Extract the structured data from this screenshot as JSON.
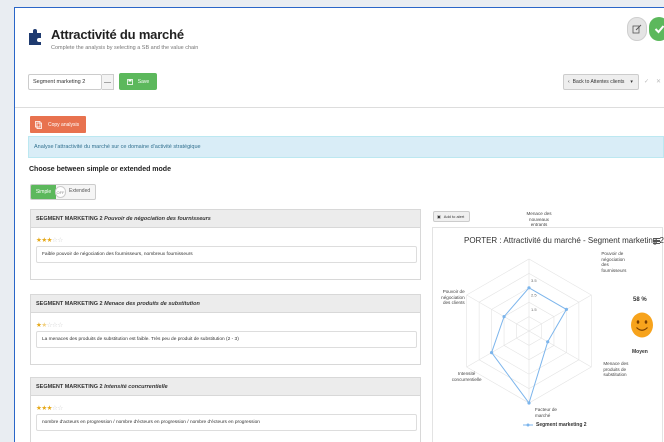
{
  "header": {
    "title": "Attractivité du marché",
    "subtitle": "Complete the analysis by selecting a SB and the value chain"
  },
  "toolbar": {
    "segment_select": "Segment marketing 2",
    "minus_label": "—",
    "save_label": "Save",
    "back_label": "Back to Attentes clients",
    "ghost_1": "✓",
    "ghost_2": "✕"
  },
  "copy_button": "Copy analysis",
  "info": "Analyse l'attractivité du marché sur ce domaine d'activité stratégique",
  "mode": {
    "label": "Choose between simple or extended mode",
    "simple": "Simple",
    "knob": "OFF",
    "extended": "Extended"
  },
  "sections": [
    {
      "segment": "SEGMENT MARKETING 2",
      "criterion": "Pouvoir de négociation des fournisseurs",
      "rating": 3,
      "text": "Faible pouvoir de négociation des fournisseurs, nombreux fournisseurs"
    },
    {
      "segment": "SEGMENT MARKETING 2",
      "criterion": "Menace des produits de substitution",
      "rating": 1.5,
      "text": "La menaces des produits de substitution est faible. Très peu de produit de substitution (2 - 3)"
    },
    {
      "segment": "SEGMENT MARKETING 2",
      "criterion": "Intensité concurrentielle",
      "rating": 3,
      "text": "nombre d'acteurs en progression / nombre d'écteurs en progression / nombre d'écteurs en progression"
    }
  ],
  "add_alert": "Add to alert",
  "chart_data": {
    "type": "radar",
    "title": "PORTER : Attractivité du marché - Segment marketing 2",
    "axes": [
      "Menace des nouveaux entrants",
      "Pouvoir de négociation des fournisseurs",
      "Menace des produits de substitution",
      "Facteur de marché",
      "Intensité concurrentielle",
      "Pouvoir de négociation des clients"
    ],
    "tick_labels": [
      "3.5",
      "2.5",
      "1.5"
    ],
    "rmax": 5,
    "series": [
      {
        "name": "Segment marketing 2",
        "values": [
          3,
          3,
          1.5,
          5,
          3,
          2
        ],
        "color": "#7cb5ec"
      }
    ],
    "legend_position": "bottom"
  },
  "score": {
    "percent": "58 %",
    "label": "Moyen",
    "face_color": "#f7a31c"
  }
}
